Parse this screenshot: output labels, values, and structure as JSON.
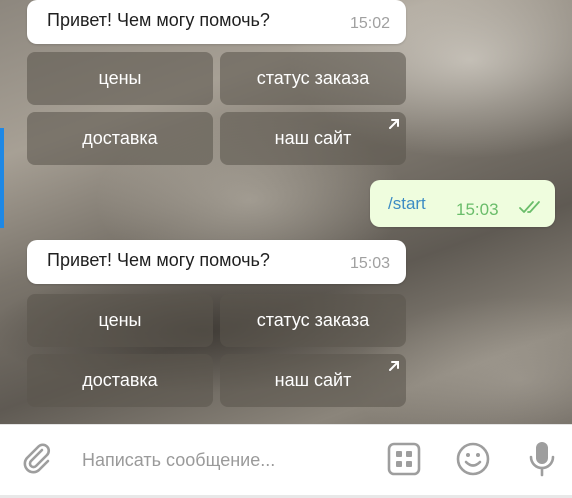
{
  "messages": [
    {
      "text": "Привет! Чем могу помочь?",
      "time": "15:02"
    },
    {
      "text": "/start",
      "time": "15:03"
    },
    {
      "text": "Привет! Чем могу помочь?",
      "time": "15:03"
    }
  ],
  "keyboard": {
    "prices": "цены",
    "order_status": "статус заказа",
    "delivery": "доставка",
    "our_site": "наш сайт"
  },
  "input": {
    "placeholder": "Написать сообщение..."
  },
  "icons": {
    "attach": "paperclip-icon",
    "bot_keyboard": "keyboard-grid-icon",
    "emoji": "emoji-smile-icon",
    "mic": "microphone-icon",
    "read_status": "double-check-icon",
    "link": "external-link-arrow-icon"
  },
  "colors": {
    "outgoing_bubble": "#effdde",
    "outgoing_text": "#3c8cc4",
    "outgoing_time": "#6abd6a",
    "icon_gray": "#9e9e9e"
  }
}
